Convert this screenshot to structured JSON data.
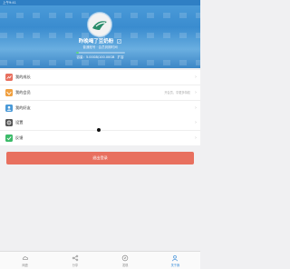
{
  "status_bar": {
    "left_text": "上午9:41",
    "right_text": ""
  },
  "profile": {
    "username": "昨晚喝了豆奶粉",
    "subinfo": "普通账号 · 会员到期时间",
    "storage": "容量：5.00GB/100.00GB",
    "storage_action": "扩容",
    "storage_fraction": 0.05
  },
  "menu_group_1": [
    {
      "label": "我的成长",
      "icon": "growth-icon",
      "color": "#e8705f",
      "hint": ""
    },
    {
      "label": "我的会员",
      "icon": "vip-icon",
      "color": "#f0a040",
      "hint": "开会员，享更多特权"
    },
    {
      "label": "我的好友",
      "icon": "friends-icon",
      "color": "#4a9ad8",
      "hint": ""
    }
  ],
  "menu_group_2": [
    {
      "label": "设置",
      "icon": "settings-icon",
      "color": "#555555",
      "hint": ""
    },
    {
      "label": "反馈",
      "icon": "feedback-icon",
      "color": "#3dbb6a",
      "hint": ""
    }
  ],
  "logout_label": "退出登录",
  "tabs": [
    {
      "label": "网盘",
      "icon": "cloud-icon",
      "active": false
    },
    {
      "label": "分享",
      "icon": "share-icon",
      "active": false
    },
    {
      "label": "发现",
      "icon": "discover-icon",
      "active": false
    },
    {
      "label": "关于我",
      "icon": "me-icon",
      "active": true
    }
  ],
  "colors": {
    "accent": "#2f86d6",
    "danger": "#e8705f",
    "header": "#3a8ccf"
  }
}
